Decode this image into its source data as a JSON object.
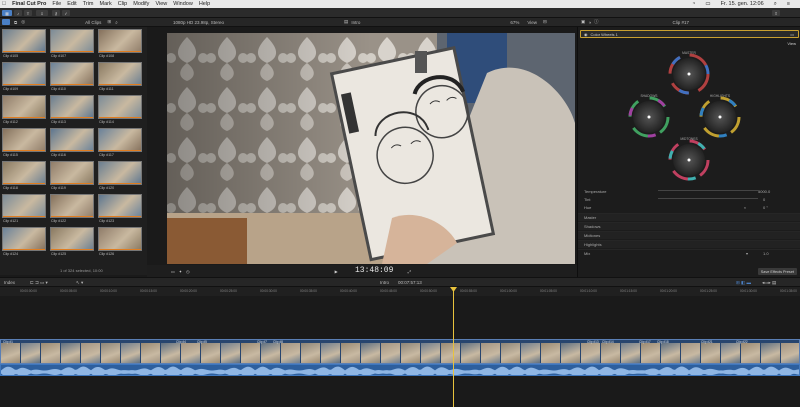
{
  "menubar": {
    "apple": "",
    "app_name": "Final Cut Pro",
    "items": [
      "File",
      "Edit",
      "Trim",
      "Mark",
      "Clip",
      "Modify",
      "View",
      "Window",
      "Help"
    ],
    "clock": "Fr. 15. gen. 12:06"
  },
  "toolbar": {
    "libraries_icon": "film-icon",
    "photos_icon": "music-icon",
    "titles_icon": "T-icon",
    "done_label": "Done"
  },
  "browser": {
    "header_label": "All Clips",
    "clips": [
      "Clip #105",
      "Clip #107",
      "Clip #108",
      "Clip #109",
      "Clip #110",
      "Clip #111",
      "Clip #112",
      "Clip #113",
      "Clip #114",
      "Clip #115",
      "Clip #116",
      "Clip #117",
      "Clip #118",
      "Clip #119",
      "Clip #120",
      "Clip #121",
      "Clip #122",
      "Clip #123",
      "Clip #124",
      "Clip #125",
      "Clip #126"
    ],
    "footer": "1 of 324 selected, 10:00"
  },
  "viewer": {
    "format": "1080p HD 23.98p, Stereo",
    "zoom": "67%",
    "view_label": "View",
    "timecode": "13:48:09",
    "clip_name": "Clip #17"
  },
  "inspector": {
    "title": "Clip #17",
    "effect_name": "Color Wheels 1",
    "view_label": "View",
    "wheels": {
      "master": "MASTER",
      "shadows": "SHADOWS",
      "highlights": "HIGHLIGHTS",
      "midtones": "MIDTONES"
    },
    "params": [
      {
        "label": "Temperature",
        "value": "5000.0"
      },
      {
        "label": "Tint",
        "value": "0"
      },
      {
        "label": "Hue",
        "value": "0 °"
      }
    ],
    "sections": [
      "Master",
      "Shadows",
      "Midtones",
      "Highlights"
    ],
    "mix_label": "Mix",
    "mix_value": "1.0",
    "save_button": "Save Effects Preset"
  },
  "timeline": {
    "index_label": "Index",
    "center_label": "Intro",
    "duration": "00:07:57:13",
    "ruler_times": [
      "00:00:00:00",
      "00:00:05:00",
      "00:00:10:00",
      "00:00:15:00",
      "00:00:20:00",
      "00:00:25:00",
      "00:00:30:00",
      "00:00:35:00",
      "00:00:40:00",
      "00:00:45:00",
      "00:00:50:00",
      "00:00:55:00",
      "00:01:00:00",
      "00:01:05:00",
      "00:01:10:00",
      "00:01:15:00",
      "00:01:20:00",
      "00:01:25:00",
      "00:01:30:00",
      "00:01:35:00"
    ],
    "clip_labels": [
      "Clip #1",
      "Clip #4",
      "Clip #5",
      "Clip #7",
      "Clip #8",
      "Clip #13",
      "Clip #14",
      "Clip #17",
      "Clip #18",
      "Clip #21",
      "Clip #22"
    ]
  },
  "colors": {
    "accent_blue": "#4a7fc4",
    "playhead": "#e8c23d",
    "selection_orange": "#e07d20"
  }
}
